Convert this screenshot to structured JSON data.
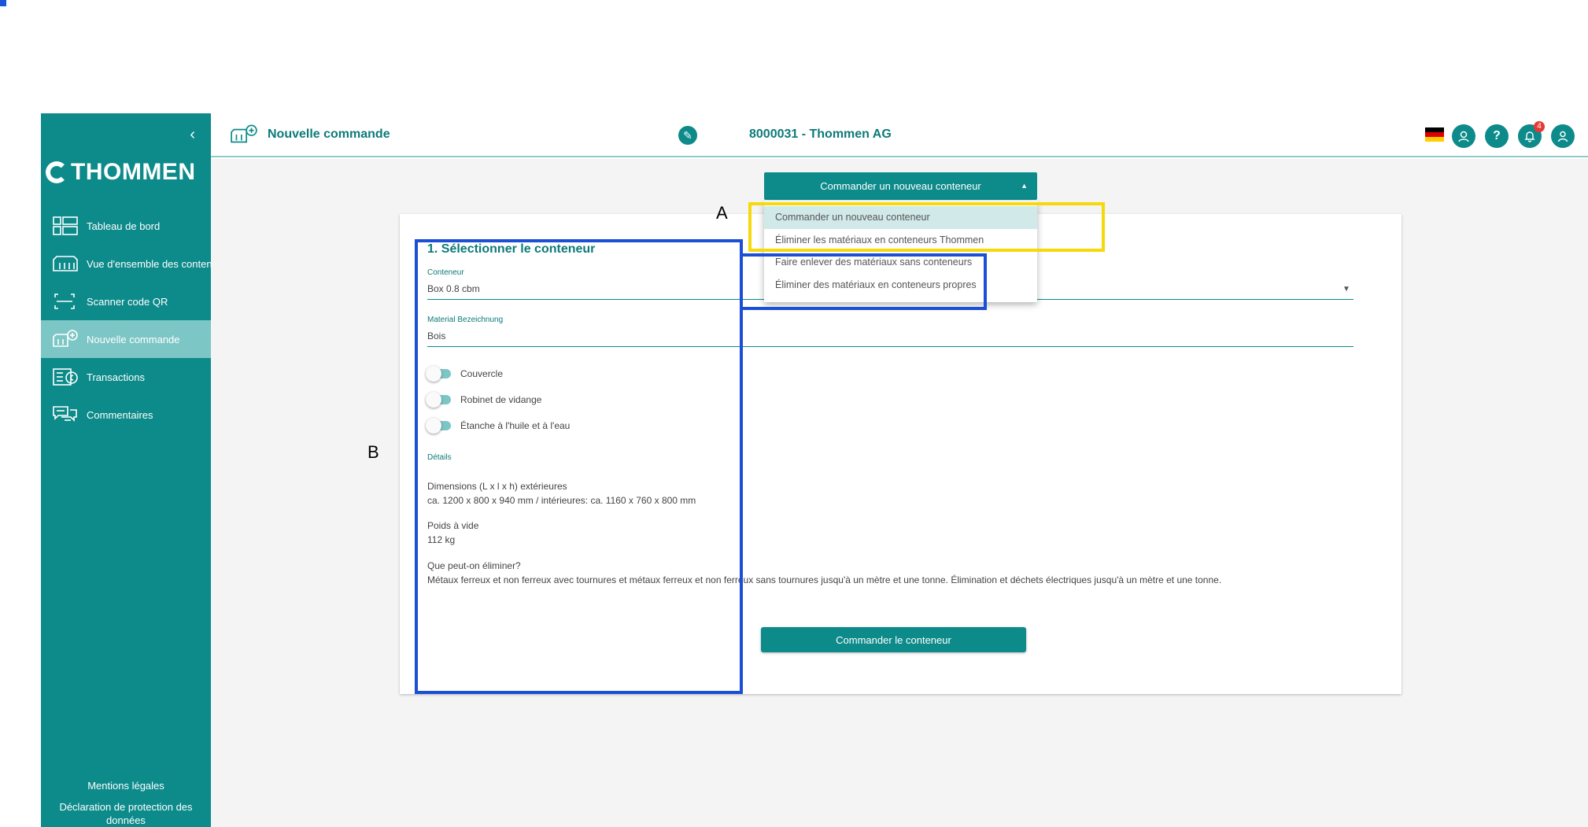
{
  "header": {
    "page_title": "Nouvelle commande",
    "customer": "8000031 - Thommen AG",
    "notification_count": "4"
  },
  "sidebar": {
    "logo_text": "THOMMEN",
    "items": [
      {
        "label": "Tableau de bord",
        "icon": "dashboard-icon"
      },
      {
        "label": "Vue d'ensemble des conteneurs",
        "icon": "containers-icon"
      },
      {
        "label": "Scanner code QR",
        "icon": "qr-scan-icon"
      },
      {
        "label": "Nouvelle commande",
        "icon": "new-order-icon",
        "active": true
      },
      {
        "label": "Transactions",
        "icon": "transactions-icon"
      },
      {
        "label": "Commentaires",
        "icon": "comments-icon"
      }
    ],
    "footer_legal": "Mentions légales",
    "footer_privacy": "Déclaration de protection des données"
  },
  "order_type": {
    "button_label": "Commander un nouveau conteneur",
    "options": [
      "Commander un nouveau conteneur",
      "Éliminer les matériaux en conteneurs Thommen",
      "Faire enlever des matériaux sans conteneurs",
      "Éliminer des matériaux en conteneurs propres"
    ]
  },
  "form": {
    "section_title": "1. Sélectionner le conteneur",
    "container_label": "Conteneur",
    "container_value": "Box 0.8 cbm",
    "material_label": "Material Bezeichnung",
    "material_value": "Bois",
    "toggles": [
      "Couvercle",
      "Robinet de vidange",
      "Étanche à l'huile et à l'eau"
    ],
    "details_label": "Détails",
    "dimensions_title": "Dimensions (L x l x h) extérieures",
    "dimensions_value": "ca. 1200 x 800 x 940 mm / intérieures: ca. 1160 x 760 x 800 mm",
    "weight_title": "Poids à vide",
    "weight_value": "112 kg",
    "dispose_title": "Que peut-on éliminer?",
    "dispose_value": "Métaux ferreux et non ferreux avec tournures et métaux ferreux et non ferreux sans tournures jusqu'à un mètre et une tonne. Élimination et déchets électriques jusqu'à un mètre et une tonne.",
    "submit_label": "Commander le conteneur"
  },
  "annotations": {
    "label_a": "A",
    "label_b": "B"
  },
  "colors": {
    "brand": "#0d8a8a",
    "active_nav": "#7dc6c6",
    "highlight_yellow": "#f5d90a",
    "highlight_blue": "#1a4fd6"
  }
}
